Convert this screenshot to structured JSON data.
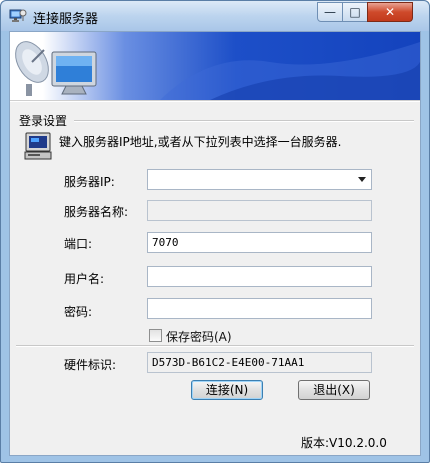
{
  "window": {
    "title": "连接服务器",
    "minimize_glyph": "—",
    "maximize_glyph": "□",
    "close_glyph": "✕"
  },
  "login": {
    "group_title": "登录设置",
    "instruction": "键入服务器IP地址,或者从下拉列表中选择一台服务器."
  },
  "form": {
    "server_ip": {
      "label": "服务器IP:",
      "value": ""
    },
    "server_name": {
      "label": "服务器名称:",
      "value": ""
    },
    "port": {
      "label": "端口:",
      "value": "7070"
    },
    "username": {
      "label": "用户名:",
      "value": ""
    },
    "password": {
      "label": "密码:",
      "value": ""
    },
    "save_password": {
      "label": "保存密码(A)",
      "checked": false
    },
    "hardware_id": {
      "label": "硬件标识:",
      "value": "D573D-B61C2-E4E00-71AA1"
    }
  },
  "buttons": {
    "connect": "连接(N)",
    "exit": "退出(X)"
  },
  "version": "版本:V10.2.0.0",
  "icons": {
    "app": "network-computer-icon",
    "banner": "satellite-dish-monitor-icon",
    "instruction": "computer-icon"
  }
}
